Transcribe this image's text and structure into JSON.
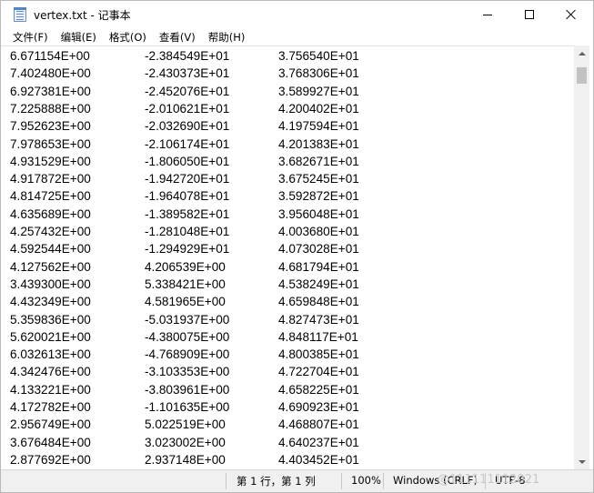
{
  "window": {
    "title": "vertex.txt - 记事本"
  },
  "menu": [
    "文件(F)",
    "编辑(E)",
    "格式(O)",
    "查看(V)",
    "帮助(H)"
  ],
  "rows": [
    [
      "6.671154E+00",
      "-2.384549E+01",
      "3.756540E+01"
    ],
    [
      "7.402480E+00",
      "-2.430373E+01",
      "3.768306E+01"
    ],
    [
      "6.927381E+00",
      "-2.452076E+01",
      "3.589927E+01"
    ],
    [
      "7.225888E+00",
      "-2.010621E+01",
      "4.200402E+01"
    ],
    [
      "7.952623E+00",
      "-2.032690E+01",
      "4.197594E+01"
    ],
    [
      "7.978653E+00",
      "-2.106174E+01",
      "4.201383E+01"
    ],
    [
      "4.931529E+00",
      "-1.806050E+01",
      "3.682671E+01"
    ],
    [
      "4.917872E+00",
      "-1.942720E+01",
      "3.675245E+01"
    ],
    [
      "4.814725E+00",
      "-1.964078E+01",
      "3.592872E+01"
    ],
    [
      "4.635689E+00",
      "-1.389582E+01",
      "3.956048E+01"
    ],
    [
      "4.257432E+00",
      "-1.281048E+01",
      "4.003680E+01"
    ],
    [
      "4.592544E+00",
      "-1.294929E+01",
      "4.073028E+01"
    ],
    [
      "4.127562E+00",
      "4.206539E+00",
      "4.681794E+01"
    ],
    [
      "3.439300E+00",
      "5.338421E+00",
      "4.538249E+01"
    ],
    [
      "4.432349E+00",
      "4.581965E+00",
      "4.659848E+01"
    ],
    [
      "5.359836E+00",
      "-5.031937E+00",
      "4.827473E+01"
    ],
    [
      "5.620021E+00",
      "-4.380075E+00",
      "4.848117E+01"
    ],
    [
      "6.032613E+00",
      "-4.768909E+00",
      "4.800385E+01"
    ],
    [
      "4.342476E+00",
      "-3.103353E+00",
      "4.722704E+01"
    ],
    [
      "4.133221E+00",
      "-3.803961E+00",
      "4.658225E+01"
    ],
    [
      "4.172782E+00",
      "-1.101635E+00",
      "4.690923E+01"
    ],
    [
      "2.956749E+00",
      "5.022519E+00",
      "4.468807E+01"
    ],
    [
      "3.676484E+00",
      "3.023002E+00",
      "4.640237E+01"
    ],
    [
      "2.877692E+00",
      "2.937148E+00",
      "4.403452E+01"
    ]
  ],
  "status": {
    "position": "第 1 行，第 1 列",
    "zoom": "100%",
    "line_ending": "Windows (CRLF)",
    "encoding": "UTF-8",
    "watermark": "@111111112021"
  }
}
